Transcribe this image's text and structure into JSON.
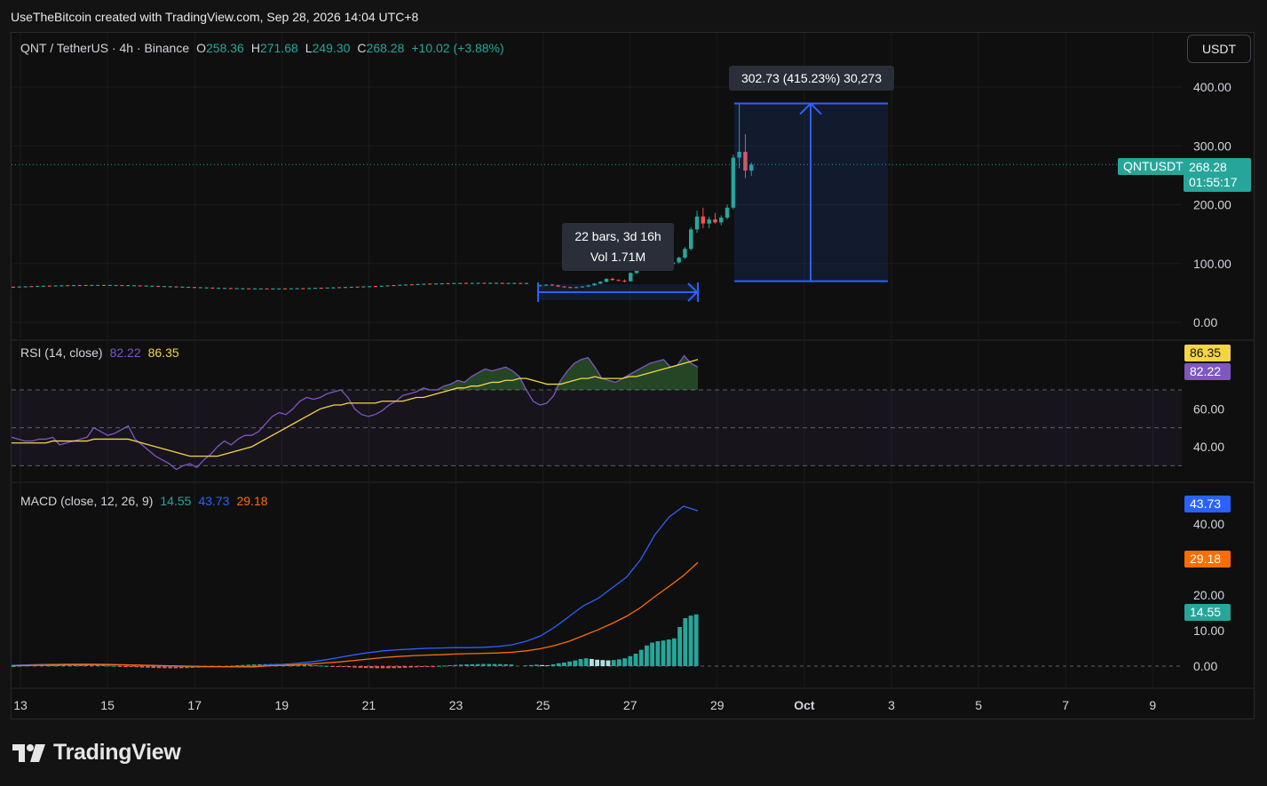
{
  "header": {
    "attribution": "UseTheBitcoin created with TradingView.com, Sep 28, 2026 14:04 UTC+8"
  },
  "symbol": {
    "title": "QNT / TetherUS · 4h · Binance",
    "o_label": "O",
    "o": "258.36",
    "h_label": "H",
    "h": "271.68",
    "l_label": "L",
    "l": "249.30",
    "c_label": "C",
    "c": "268.28",
    "change": "+10.02 (+3.88%)",
    "currency": "USDT",
    "ticker_tag": "QNTUSDT",
    "last_price": "268.28",
    "countdown": "01:55:17"
  },
  "price_axis": [
    "400.00",
    "300.00",
    "200.00",
    "100.00",
    "0.00"
  ],
  "measure": {
    "bars_text": "22 bars, 3d 16h",
    "vol_text": "Vol 1.71M",
    "range_text": "302.73 (415.23%) 30,273"
  },
  "rsi": {
    "title": "RSI (14, close)",
    "value": "82.22",
    "ma": "86.35",
    "axis": [
      "60.00",
      "40.00"
    ]
  },
  "macd": {
    "title": "MACD (close, 12, 26, 9)",
    "hist": "14.55",
    "macd": "43.73",
    "signal": "29.18",
    "axis": [
      "40.00",
      "20.00",
      "10.00",
      "0.00"
    ]
  },
  "time_axis": [
    "13",
    "15",
    "17",
    "19",
    "21",
    "23",
    "25",
    "27",
    "29",
    "Oct",
    "3",
    "5",
    "7",
    "9"
  ],
  "footer": {
    "brand": "TradingView"
  },
  "colors": {
    "up": "#26a69a",
    "down": "#ef5350",
    "rsi": "#7e57c2",
    "rsi_ma": "#f5d547",
    "macd": "#2962ff",
    "signal": "#ff6d00",
    "measure": "#2962ff"
  },
  "chart_data": [
    {
      "type": "candlestick",
      "title": "QNT / TetherUS · 4h · Binance",
      "x": [
        "25",
        "26",
        "27",
        "28"
      ],
      "ylim": [
        0,
        420
      ],
      "last_close": 268.28,
      "candles": [
        {
          "o": 62,
          "h": 64,
          "l": 61,
          "c": 63
        },
        {
          "o": 63,
          "h": 65,
          "l": 62,
          "c": 64
        },
        {
          "o": 64,
          "h": 66,
          "l": 62,
          "c": 63
        },
        {
          "o": 63,
          "h": 64,
          "l": 60,
          "c": 61
        },
        {
          "o": 61,
          "h": 62,
          "l": 59,
          "c": 60
        },
        {
          "o": 60,
          "h": 61,
          "l": 58,
          "c": 59
        },
        {
          "o": 59,
          "h": 61,
          "l": 58,
          "c": 60
        },
        {
          "o": 60,
          "h": 62,
          "l": 59,
          "c": 61
        },
        {
          "o": 61,
          "h": 64,
          "l": 60,
          "c": 63
        },
        {
          "o": 63,
          "h": 67,
          "l": 62,
          "c": 66
        },
        {
          "o": 66,
          "h": 70,
          "l": 65,
          "c": 69
        },
        {
          "o": 69,
          "h": 75,
          "l": 68,
          "c": 74
        },
        {
          "o": 74,
          "h": 76,
          "l": 71,
          "c": 72
        },
        {
          "o": 72,
          "h": 73,
          "l": 70,
          "c": 71
        },
        {
          "o": 71,
          "h": 73,
          "l": 68,
          "c": 70
        },
        {
          "o": 70,
          "h": 85,
          "l": 69,
          "c": 84
        },
        {
          "o": 84,
          "h": 92,
          "l": 82,
          "c": 90
        },
        {
          "o": 90,
          "h": 98,
          "l": 88,
          "c": 96
        },
        {
          "o": 96,
          "h": 101,
          "l": 92,
          "c": 98
        },
        {
          "o": 98,
          "h": 100,
          "l": 94,
          "c": 95
        },
        {
          "o": 95,
          "h": 98,
          "l": 93,
          "c": 97
        },
        {
          "o": 97,
          "h": 101,
          "l": 95,
          "c": 99
        },
        {
          "o": 99,
          "h": 104,
          "l": 97,
          "c": 102
        },
        {
          "o": 102,
          "h": 112,
          "l": 100,
          "c": 110
        },
        {
          "o": 110,
          "h": 128,
          "l": 108,
          "c": 125
        },
        {
          "o": 125,
          "h": 162,
          "l": 122,
          "c": 158
        },
        {
          "o": 158,
          "h": 190,
          "l": 152,
          "c": 180
        },
        {
          "o": 180,
          "h": 195,
          "l": 160,
          "c": 168
        },
        {
          "o": 168,
          "h": 180,
          "l": 160,
          "c": 175
        },
        {
          "o": 175,
          "h": 186,
          "l": 168,
          "c": 170
        },
        {
          "o": 170,
          "h": 182,
          "l": 165,
          "c": 178
        },
        {
          "o": 178,
          "h": 200,
          "l": 175,
          "c": 195
        },
        {
          "o": 195,
          "h": 285,
          "l": 192,
          "c": 280
        },
        {
          "o": 280,
          "h": 372,
          "l": 262,
          "c": 290
        },
        {
          "o": 290,
          "h": 320,
          "l": 245,
          "c": 258
        },
        {
          "o": 258,
          "h": 272,
          "l": 249,
          "c": 268
        }
      ],
      "measure_range": {
        "from": 70,
        "to": 372,
        "change": "302.73 (415.23%) 30,273"
      }
    },
    {
      "type": "line",
      "title": "RSI (14, close)",
      "ylim": [
        25,
        92
      ],
      "bands": [
        30,
        50,
        70
      ],
      "series": [
        {
          "name": "RSI",
          "values": [
            45,
            44,
            43,
            43,
            44,
            44,
            45,
            41,
            42,
            43,
            44,
            45,
            50,
            48,
            46,
            47,
            49,
            51,
            44,
            41,
            38,
            35,
            33,
            31,
            28,
            30,
            31,
            29,
            33,
            36,
            40,
            43,
            41,
            44,
            46,
            46,
            48,
            52,
            56,
            58,
            57,
            60,
            64,
            66,
            65,
            66,
            68,
            69,
            70,
            66,
            60,
            57,
            56,
            57,
            59,
            62,
            64,
            67,
            68,
            69,
            71,
            70,
            70,
            72,
            73,
            75,
            74,
            77,
            79,
            81,
            80,
            81,
            82,
            80,
            77,
            70,
            64,
            62,
            63,
            67,
            75,
            80,
            84,
            86,
            87,
            82,
            76,
            75,
            74,
            76,
            78,
            80,
            82,
            84,
            85,
            86,
            82,
            83,
            88,
            84,
            82
          ]
        },
        {
          "name": "MA",
          "values": [
            42,
            42,
            42,
            42,
            42,
            42,
            43,
            43,
            43,
            43,
            43,
            43,
            44,
            44,
            44,
            44,
            44,
            44,
            43,
            42,
            41,
            40,
            39,
            38,
            37,
            36,
            35,
            35,
            35,
            35,
            35,
            36,
            37,
            38,
            39,
            40,
            42,
            44,
            46,
            48,
            50,
            52,
            54,
            56,
            58,
            60,
            61,
            62,
            62,
            63,
            63,
            63,
            63,
            63,
            64,
            64,
            64,
            64,
            65,
            66,
            66,
            67,
            68,
            69,
            70,
            71,
            71,
            72,
            72,
            73,
            74,
            74,
            75,
            75,
            76,
            76,
            75,
            74,
            73,
            73,
            73,
            74,
            75,
            76,
            76,
            77,
            76,
            76,
            76,
            76,
            77,
            77,
            78,
            79,
            80,
            81,
            82,
            83,
            84,
            85,
            86
          ]
        }
      ]
    },
    {
      "type": "bar",
      "title": "MACD (close, 12, 26, 9)",
      "ylim": [
        -3,
        48
      ],
      "series": [
        {
          "name": "Histogram",
          "values": [
            0.2,
            0.3,
            0.4,
            0.3,
            0.2,
            0.5,
            0.8,
            1,
            1.3,
            1.6,
            2,
            2.2,
            2,
            1.8,
            1.7,
            1.6,
            1.7,
            1.9,
            2.2,
            2.8,
            3.5,
            4.6,
            5.8,
            6.6,
            7,
            7.2,
            7.5,
            7.8,
            11,
            13.5,
            14.2,
            14.55
          ]
        },
        {
          "name": "MACD",
          "values": [
            0.3,
            0.5,
            0.8,
            1.2,
            1.8,
            2.5,
            3.2,
            3.8,
            4.3,
            4.6,
            4.8,
            5,
            5.1,
            5.2,
            5.2,
            5.3,
            5.5,
            6,
            7,
            8.5,
            11,
            14,
            17,
            19,
            22,
            25,
            30,
            37,
            42,
            45,
            43.73
          ]
        },
        {
          "name": "Signal",
          "values": [
            0.1,
            0.2,
            0.4,
            0.6,
            0.9,
            1.2,
            1.6,
            2,
            2.4,
            2.7,
            2.9,
            3.1,
            3.2,
            3.4,
            3.5,
            3.6,
            3.7,
            3.9,
            4.3,
            4.9,
            5.8,
            7,
            8.6,
            10.2,
            12,
            14,
            16.5,
            19.6,
            22.5,
            25.5,
            29.18
          ]
        }
      ]
    }
  ]
}
